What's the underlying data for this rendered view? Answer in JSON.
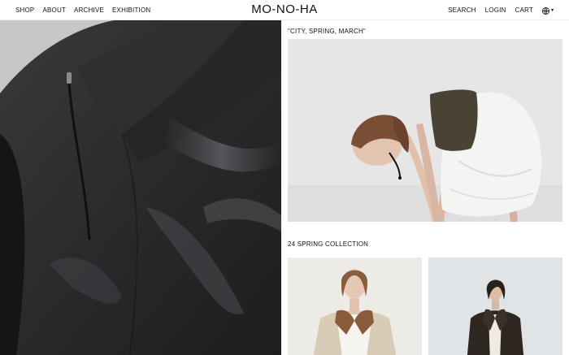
{
  "header": {
    "nav_left": [
      "SHOP",
      "ABOUT",
      "ARCHIVE",
      "EXHIBITION"
    ],
    "logo": "MO-NO-HA",
    "nav_right": [
      "SEARCH",
      "LOGIN",
      "CART"
    ],
    "language_icon": "globe-icon",
    "language_caret": "▾"
  },
  "main": {
    "hero": {
      "icon": "image",
      "subject": "dark leather jacket close-up"
    },
    "feature": {
      "title": "\"CITY, SPRING, MARCH\""
    },
    "collection": {
      "title": "24 SPRING COLLECTION"
    }
  },
  "colors": {
    "background": "#ffffff",
    "text": "#111111",
    "border": "#ececec"
  }
}
